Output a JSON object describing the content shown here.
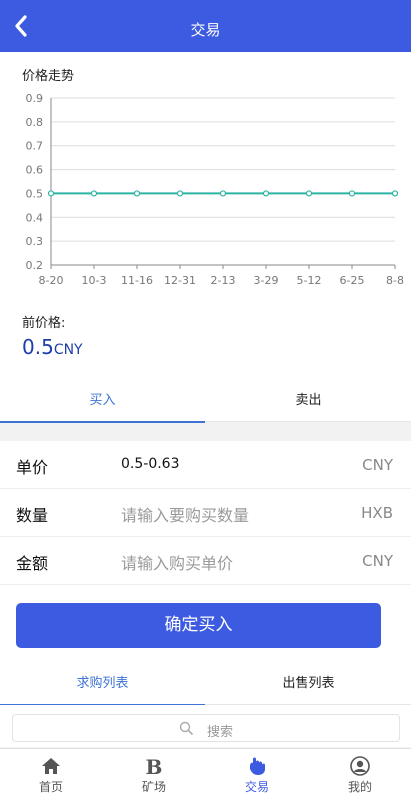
{
  "header": {
    "title": "交易"
  },
  "chart_section": {
    "title": "价格走势",
    "price_label": "前价格:",
    "price_value": "0.5",
    "price_unit": "CNY"
  },
  "chart_data": {
    "type": "line",
    "categories": [
      "8-20",
      "10-3",
      "11-16",
      "12-31",
      "2-13",
      "3-29",
      "5-12",
      "6-25",
      "8-8"
    ],
    "series": [
      {
        "values": [
          0.5,
          0.5,
          0.5,
          0.5,
          0.5,
          0.5,
          0.5,
          0.5,
          0.5
        ]
      }
    ],
    "ylim": [
      0.2,
      0.9
    ],
    "yticks": [
      "0.2",
      "0.3",
      "0.4",
      "0.5",
      "0.6",
      "0.7",
      "0.8",
      "0.9"
    ],
    "grid": true,
    "line_color": "#2bb3a3"
  },
  "trade_tabs": {
    "buy": "买入",
    "sell": "卖出"
  },
  "form": {
    "price": {
      "label": "单价",
      "value": "0.5-0.63",
      "unit": "CNY"
    },
    "quantity": {
      "label": "数量",
      "placeholder": "请输入要购买数量",
      "unit": "HXB"
    },
    "amount": {
      "label": "金额",
      "placeholder": "请输入购买单价",
      "unit": "CNY"
    },
    "confirm_label": "确定买入"
  },
  "list_tabs": {
    "buy_list": "求购列表",
    "sell_list": "出售列表"
  },
  "search": {
    "placeholder": "搜索"
  },
  "nav": [
    {
      "label": "首页",
      "icon": "home-icon"
    },
    {
      "label": "矿场",
      "icon": "bold-b-icon"
    },
    {
      "label": "交易",
      "icon": "hand-icon"
    },
    {
      "label": "我的",
      "icon": "user-icon"
    }
  ],
  "colors": {
    "primary": "#3d5be0",
    "tab_active": "#3d73d6",
    "price_value": "#1e3ea8"
  }
}
